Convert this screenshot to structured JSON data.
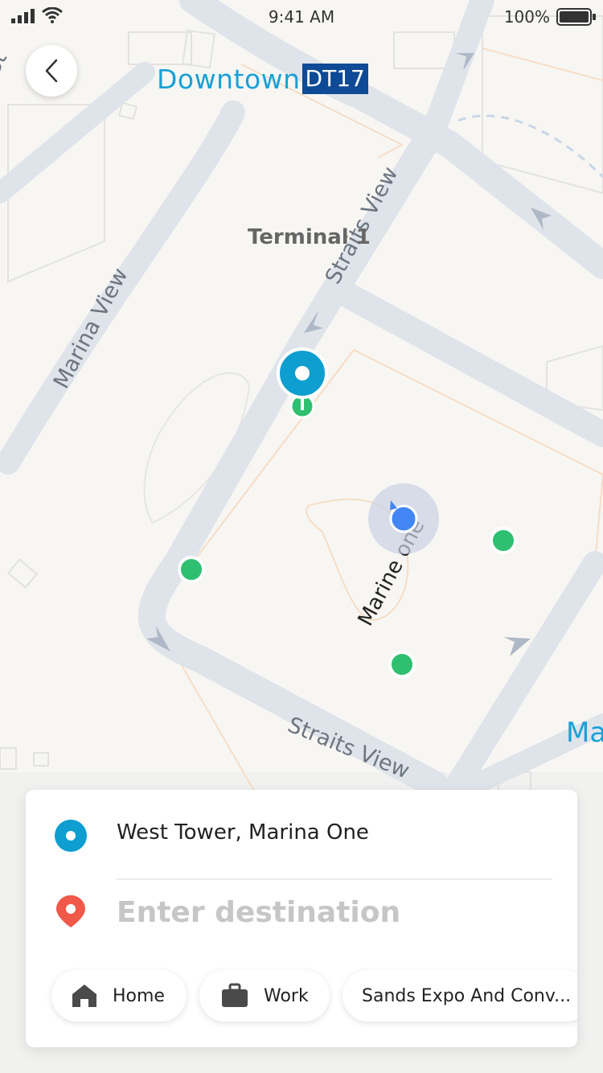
{
  "status_bar": {
    "time": "9:41 AM",
    "battery_percent": "100%"
  },
  "map": {
    "station": {
      "name": "Downtown",
      "code": "DT17"
    },
    "labels": {
      "terminal": "Terminal 1",
      "straits_view_upper": "Straits View",
      "marina_view": "Marina View",
      "marine_one": "Marine one",
      "straits_view_lower": "Straits View",
      "edge_left": "St",
      "edge_right": "Ma"
    },
    "pickup_points_count": 4
  },
  "trip": {
    "origin": "West Tower, Marina One",
    "destination_placeholder": "Enter destination",
    "destination_value": ""
  },
  "shortcuts": {
    "home": "Home",
    "work": "Work",
    "recent": "Sands Expo And Conv..."
  },
  "colors": {
    "origin_blue": "#0e9ed0",
    "destination_red": "#f0594a",
    "pickup_green": "#2fbf71",
    "current_location_blue": "#4286f4",
    "station_code_bg": "#0e4a95"
  },
  "icons": [
    "back-icon",
    "origin-icon",
    "destination-pin-icon",
    "home-icon",
    "briefcase-icon",
    "signal-icon",
    "wifi-icon",
    "battery-icon"
  ]
}
